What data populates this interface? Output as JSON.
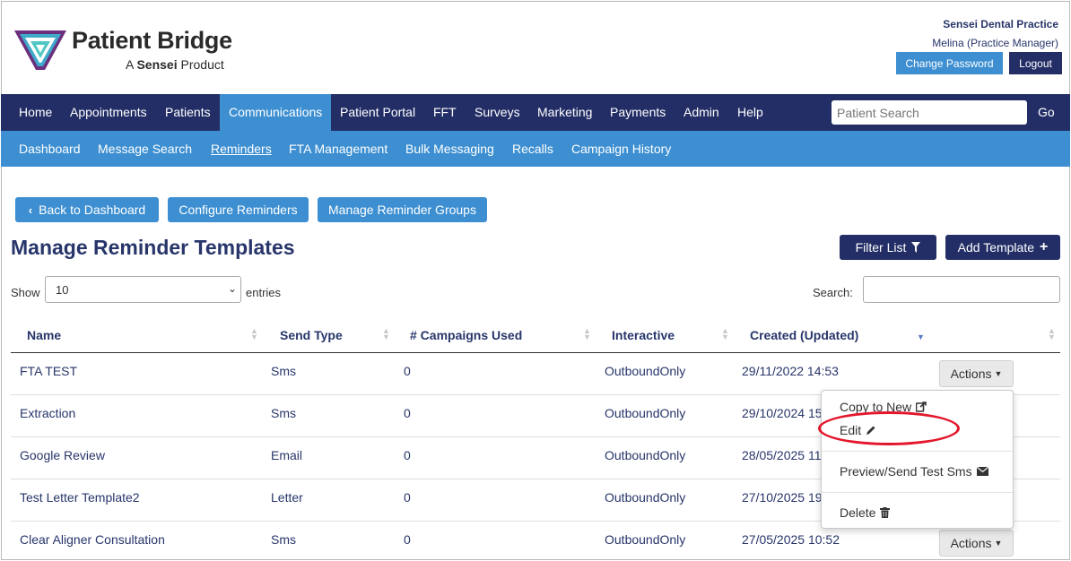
{
  "header": {
    "brand_title": "Patient Bridge",
    "brand_sub_prefix": "A ",
    "brand_sub_bold": "Sensei",
    "brand_sub_suffix": " Product",
    "practice_name": "Sensei Dental Practice",
    "user_name": "Melina (Practice Manager)",
    "change_password": "Change Password",
    "logout": "Logout"
  },
  "nav": {
    "items": [
      "Home",
      "Appointments",
      "Patients",
      "Communications",
      "Patient Portal",
      "FFT",
      "Surveys",
      "Marketing",
      "Payments",
      "Admin",
      "Help"
    ],
    "active": "Communications",
    "search_placeholder": "Patient Search",
    "go": "Go"
  },
  "subnav": {
    "items": [
      "Dashboard",
      "Message Search",
      "Reminders",
      "FTA Management",
      "Bulk Messaging",
      "Recalls",
      "Campaign History"
    ],
    "active": "Reminders"
  },
  "page": {
    "back_button": "Back to Dashboard",
    "configure_button": "Configure Reminders",
    "groups_button": "Manage Reminder Groups",
    "title": "Manage Reminder Templates",
    "filter_button": "Filter List",
    "add_button": "Add Template",
    "show_label": "Show",
    "show_value": "10",
    "entries_label": "entries",
    "search_label": "Search:"
  },
  "table": {
    "columns": [
      "Name",
      "Send Type",
      "# Campaigns Used",
      "Interactive",
      "Created (Updated)"
    ],
    "rows": [
      {
        "name": "FTA TEST",
        "send_type": "Sms",
        "campaigns": "0",
        "interactive": "OutboundOnly",
        "created": "29/11/2022 14:53"
      },
      {
        "name": "Extraction",
        "send_type": "Sms",
        "campaigns": "0",
        "interactive": "OutboundOnly",
        "created": "29/10/2024 15"
      },
      {
        "name": "Google Review",
        "send_type": "Email",
        "campaigns": "0",
        "interactive": "OutboundOnly",
        "created": "28/05/2025 11"
      },
      {
        "name": "Test Letter Template2",
        "send_type": "Letter",
        "campaigns": "0",
        "interactive": "OutboundOnly",
        "created": "27/10/2025 19"
      },
      {
        "name": "Clear Aligner Consultation",
        "send_type": "Sms",
        "campaigns": "0",
        "interactive": "OutboundOnly",
        "created": "27/05/2025 10:52"
      }
    ],
    "actions_label": "Actions"
  },
  "actions_menu": {
    "copy": "Copy to New",
    "edit": "Edit",
    "preview": "Preview/Send Test Sms",
    "delete": "Delete"
  },
  "colors": {
    "navy": "#232e66",
    "blue": "#3d8fd1",
    "highlight": "#e3162b"
  }
}
